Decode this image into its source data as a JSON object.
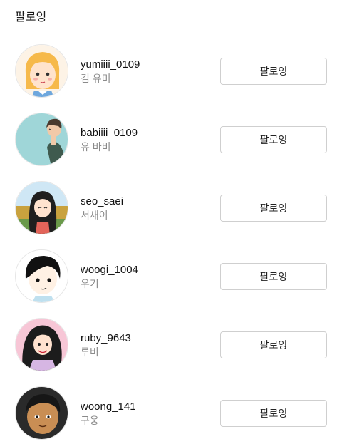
{
  "header": {
    "title": "팔로잉"
  },
  "following": [
    {
      "username": "yumiiii_0109",
      "name": "김 유미",
      "button": "팔로잉",
      "avatar_icon": "avatar-yumi-icon"
    },
    {
      "username": "babiiii_0109",
      "name": "유 바비",
      "button": "팔로잉",
      "avatar_icon": "avatar-babi-icon"
    },
    {
      "username": "seo_saei",
      "name": "서새이",
      "button": "팔로잉",
      "avatar_icon": "avatar-saei-icon"
    },
    {
      "username": "woogi_1004",
      "name": "우기",
      "button": "팔로잉",
      "avatar_icon": "avatar-woogi-icon"
    },
    {
      "username": "ruby_9643",
      "name": "루비",
      "button": "팔로잉",
      "avatar_icon": "avatar-ruby-icon"
    },
    {
      "username": "woong_141",
      "name": "구웅",
      "button": "팔로잉",
      "avatar_icon": "avatar-woong-icon"
    }
  ],
  "colors": {
    "button_border": "#cfcfcf",
    "secondary_text": "#8a8a8a"
  }
}
